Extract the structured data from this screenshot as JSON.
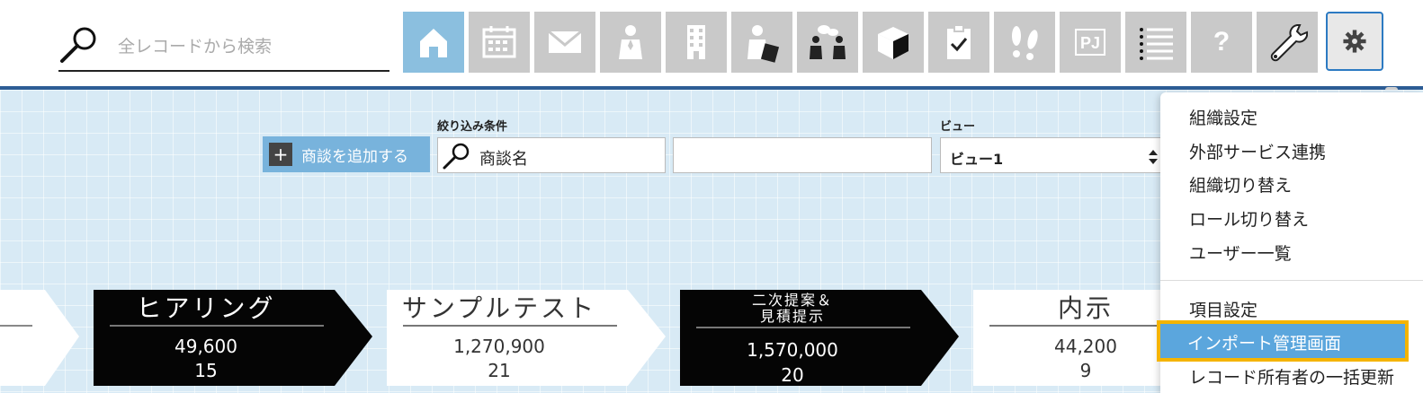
{
  "search": {
    "placeholder": "全レコードから検索"
  },
  "toolbar": {
    "buttons": [
      {
        "icon": "home-icon",
        "active": true
      },
      {
        "icon": "calendar-icon"
      },
      {
        "icon": "mail-icon"
      },
      {
        "icon": "person-icon"
      },
      {
        "icon": "building-icon"
      },
      {
        "icon": "business-person-card-icon"
      },
      {
        "icon": "meeting-icon"
      },
      {
        "icon": "product-box-icon"
      },
      {
        "icon": "clipboard-check-icon"
      },
      {
        "icon": "footprints-icon"
      },
      {
        "icon": "project-icon",
        "text": "PJ"
      },
      {
        "icon": "list-icon"
      },
      {
        "icon": "help-icon",
        "text": "?"
      },
      {
        "icon": "wrench-icon"
      },
      {
        "icon": "gear-icon",
        "selected": true
      }
    ]
  },
  "filters": {
    "add_button_label": "商談を追加する",
    "filter_label": "絞り込み条件",
    "filter_value": "商談名",
    "filter_value2": "",
    "view_label": "ビュー",
    "view_value": "ビュー1"
  },
  "pipeline": {
    "stages": [
      {
        "title": "ヒアリング",
        "amount": "49,600",
        "count": "15",
        "style": "dark"
      },
      {
        "title": "サンプルテスト",
        "amount": "1,270,900",
        "count": "21",
        "style": "light"
      },
      {
        "title_line1": "二次提案＆",
        "title_line2": "見積提示",
        "amount": "1,570,000",
        "count": "20",
        "style": "dark"
      },
      {
        "title": "内示",
        "amount": "44,200",
        "count": "9",
        "style": "light"
      }
    ]
  },
  "menu": {
    "items": [
      "組織設定",
      "外部サービス連携",
      "組織切り替え",
      "ロール切り替え",
      "ユーザー一覧"
    ],
    "items2": [
      "項目設定",
      "インポート管理画面",
      "レコード所有者の一括更新"
    ],
    "highlighted": "インポート管理画面"
  },
  "colors": {
    "nav_button": "#c9c9c9",
    "nav_active": "#8bbfdf",
    "header_line": "#2d5d95",
    "background": "#d8eaf5",
    "menu_highlight": "#5ba6dd",
    "highlight_border": "#f5b400"
  }
}
